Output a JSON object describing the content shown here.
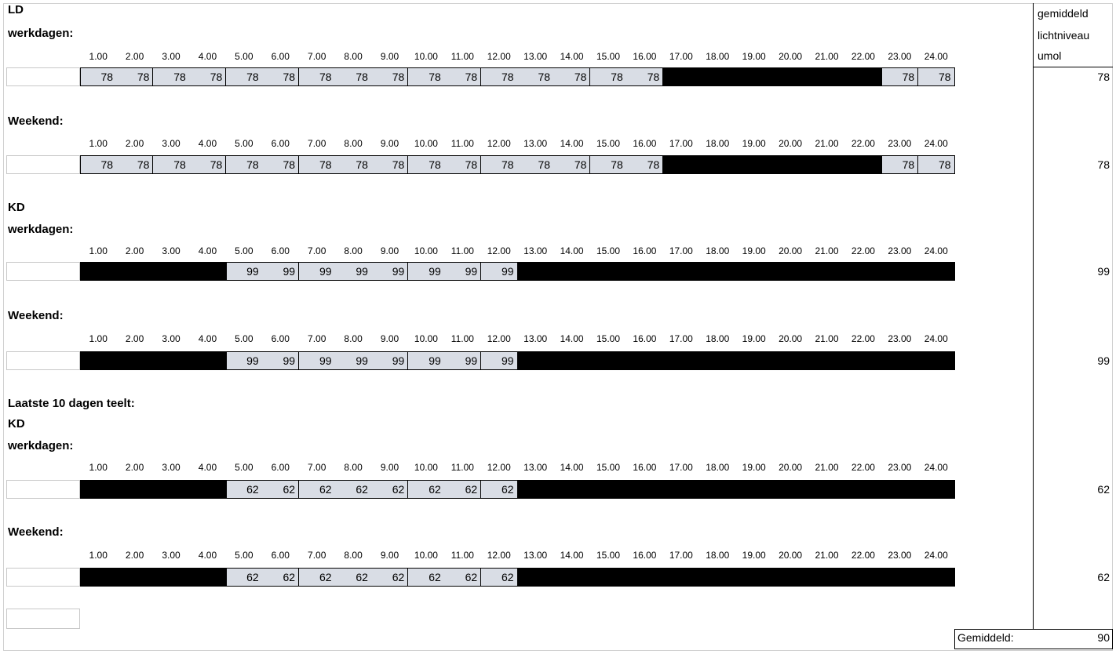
{
  "hours": [
    "1.00",
    "2.00",
    "3.00",
    "4.00",
    "5.00",
    "6.00",
    "7.00",
    "8.00",
    "9.00",
    "10.00",
    "11.00",
    "12.00",
    "13.00",
    "14.00",
    "15.00",
    "16.00",
    "17.00",
    "18.00",
    "19.00",
    "20.00",
    "21.00",
    "22.00",
    "23.00",
    "24.00"
  ],
  "avg_header": [
    "gemiddeld",
    "lichtniveau",
    "umol"
  ],
  "labels": {
    "ld": "LD",
    "werkdagen": "werkdagen:",
    "weekend": "Weekend:",
    "kd": "KD",
    "laatste": "Laatste 10 dagen teelt:"
  },
  "blocks": [
    {
      "title_lines": [
        "LD",
        "werkdagen:"
      ],
      "values": [
        78,
        78,
        78,
        78,
        78,
        78,
        78,
        78,
        78,
        78,
        78,
        78,
        78,
        78,
        78,
        78,
        null,
        null,
        null,
        null,
        null,
        null,
        78,
        78
      ],
      "average": "78"
    },
    {
      "title_lines": [
        "Weekend:"
      ],
      "values": [
        78,
        78,
        78,
        78,
        78,
        78,
        78,
        78,
        78,
        78,
        78,
        78,
        78,
        78,
        78,
        78,
        null,
        null,
        null,
        null,
        null,
        null,
        78,
        78
      ],
      "average": "78"
    },
    {
      "title_lines": [
        "KD",
        "werkdagen:"
      ],
      "values": [
        null,
        null,
        null,
        null,
        99,
        99,
        99,
        99,
        99,
        99,
        99,
        99,
        null,
        null,
        null,
        null,
        null,
        null,
        null,
        null,
        null,
        null,
        null,
        null
      ],
      "average": "99"
    },
    {
      "title_lines": [
        "Weekend:"
      ],
      "values": [
        null,
        null,
        null,
        null,
        99,
        99,
        99,
        99,
        99,
        99,
        99,
        99,
        null,
        null,
        null,
        null,
        null,
        null,
        null,
        null,
        null,
        null,
        null,
        null
      ],
      "average": "99"
    },
    {
      "title_lines": [
        "Laatste 10 dagen teelt:",
        "KD",
        "werkdagen:"
      ],
      "values": [
        null,
        null,
        null,
        null,
        62,
        62,
        62,
        62,
        62,
        62,
        62,
        62,
        null,
        null,
        null,
        null,
        null,
        null,
        null,
        null,
        null,
        null,
        null,
        null
      ],
      "average": "62"
    },
    {
      "title_lines": [
        "Weekend:"
      ],
      "values": [
        null,
        null,
        null,
        null,
        62,
        62,
        62,
        62,
        62,
        62,
        62,
        62,
        null,
        null,
        null,
        null,
        null,
        null,
        null,
        null,
        null,
        null,
        null,
        null
      ],
      "average": "62"
    }
  ],
  "total": {
    "label": "Gemiddeld:",
    "value": "90"
  }
}
